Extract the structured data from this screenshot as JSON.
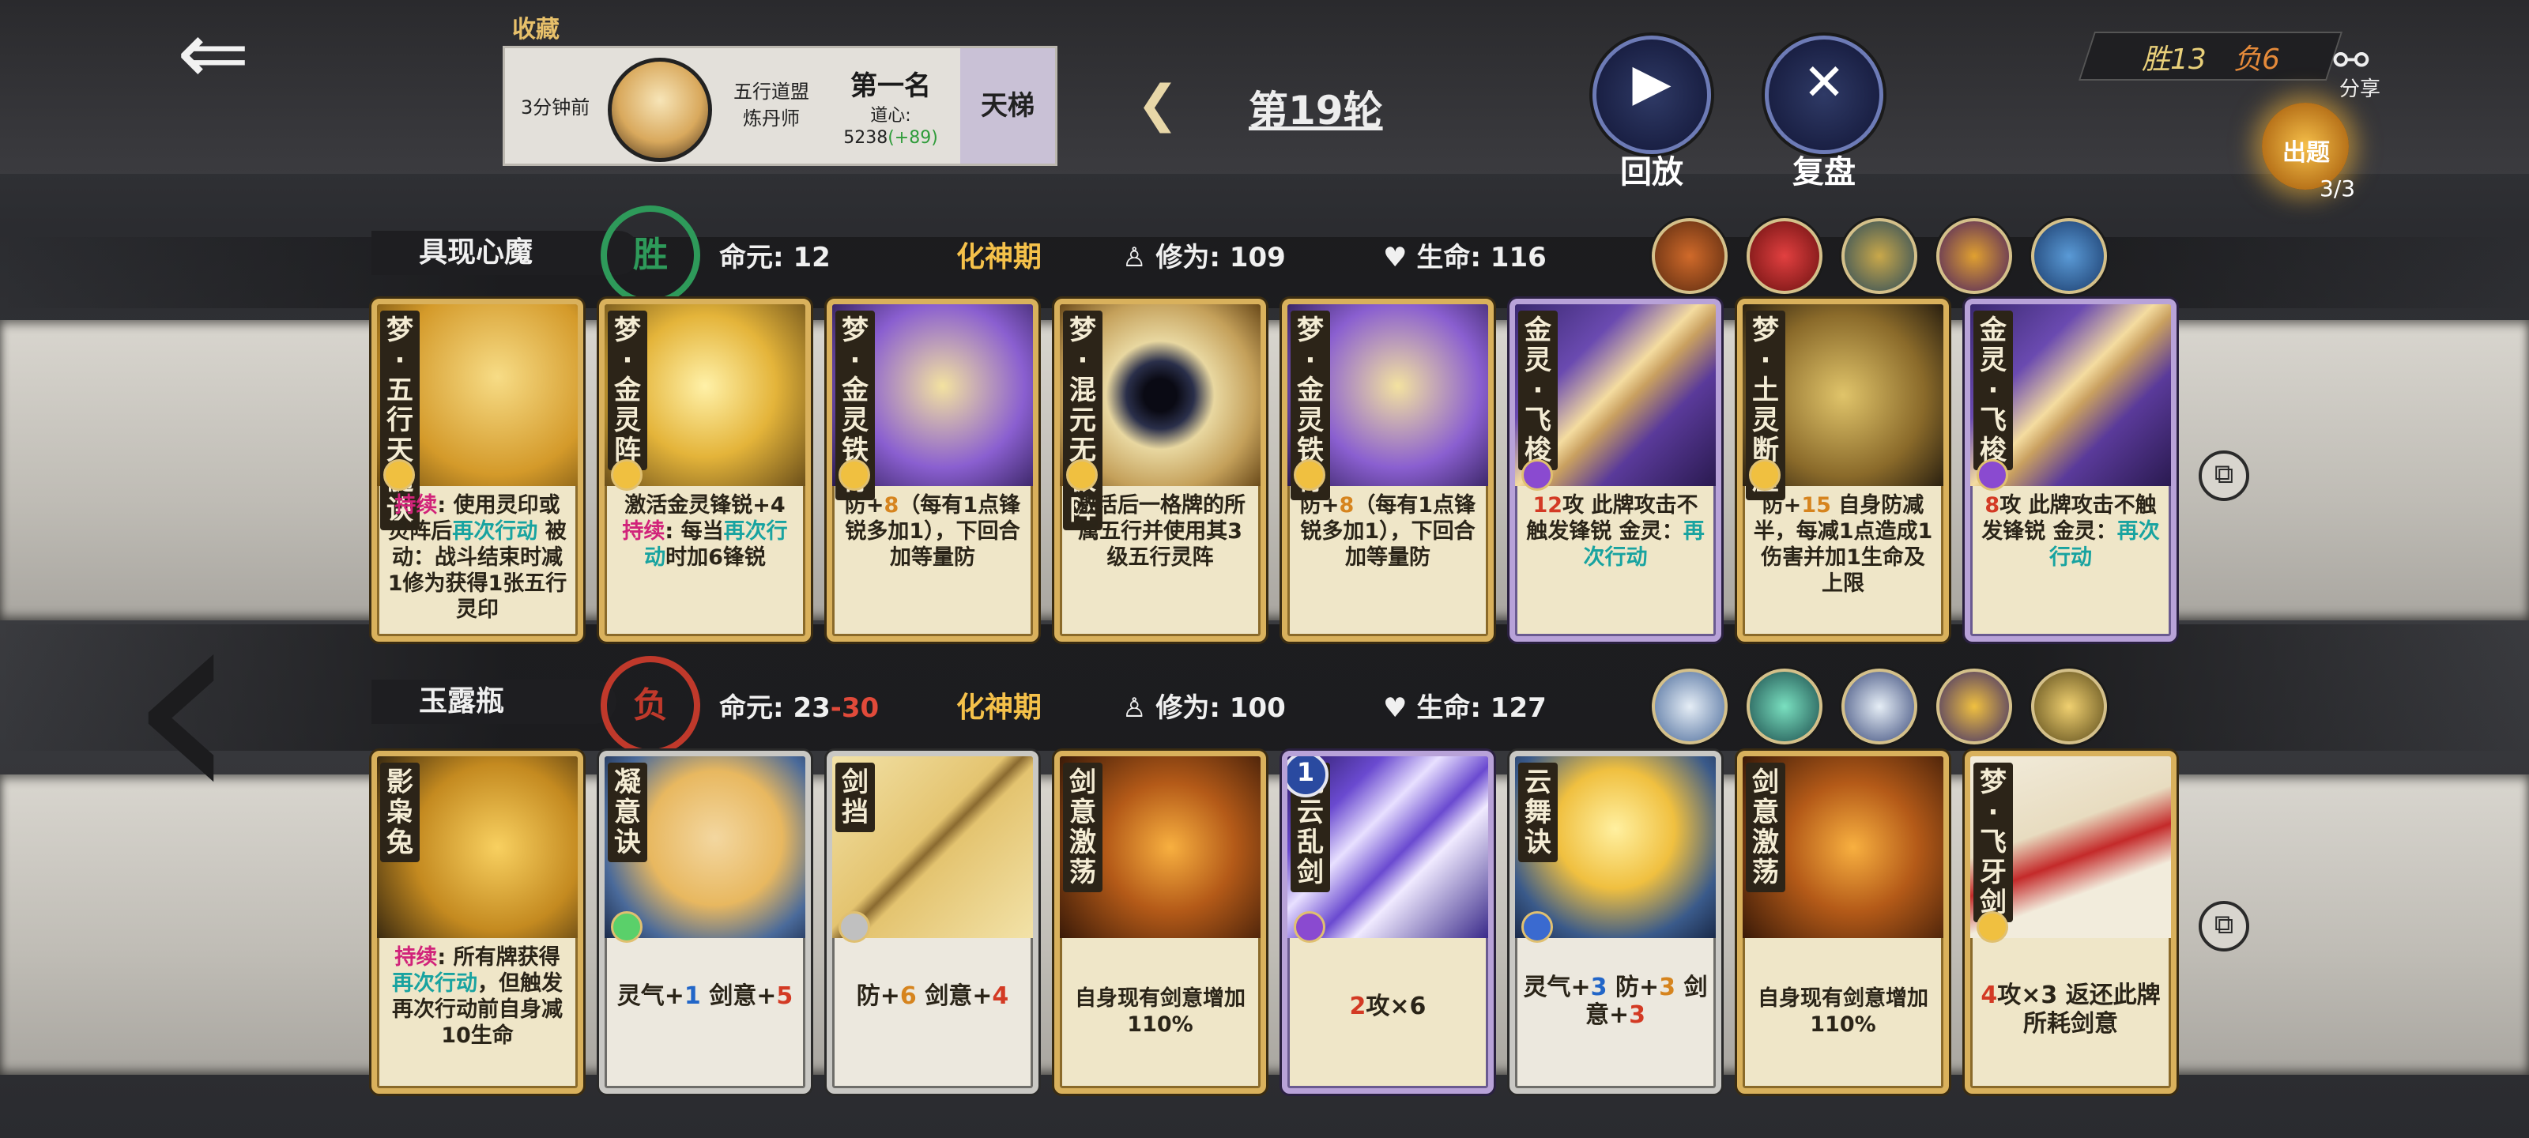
{
  "header": {
    "favorite_label": "收藏",
    "time_ago": "3分钟前",
    "guild_line1": "五行道盟",
    "guild_line2": "炼丹师",
    "rank": "第一名",
    "dao_label": "道心:",
    "dao_value": "5238",
    "dao_delta": "(+89)",
    "ladder": "天梯",
    "round": "第19轮",
    "replay_label": "回放",
    "review_label": "复盘",
    "win_record": "胜13",
    "loss_record": "负6",
    "share_label": "分享",
    "topic_label": "出题",
    "topic_count": "3/3"
  },
  "players": [
    {
      "name": "具现心魔",
      "result": "胜",
      "result_color": "#2e9a5a",
      "life_label": "命元:",
      "life_value": "12",
      "life_loss": "",
      "realm": "化神期",
      "cultivation_label": "修为:",
      "cultivation_value": "109",
      "hp_label": "生命:",
      "hp_value": "116",
      "cards": [
        {
          "name": "梦·五行天髓诀",
          "text_parts": [
            [
              "持续",
              "pink"
            ],
            [
              ": 使用灵印或灵阵后",
              ""
            ],
            [
              "再次行动",
              "teal"
            ],
            [
              " 被动：战斗结束时减1修为获得1张五行灵印",
              ""
            ]
          ]
        },
        {
          "name": "梦·金灵阵",
          "text_parts": [
            [
              "激活金灵锋锐+4 ",
              ""
            ],
            [
              "持续",
              "pink"
            ],
            [
              ": 每当",
              ""
            ],
            [
              "再次行动",
              "teal"
            ],
            [
              "时加6锋锐",
              ""
            ]
          ]
        },
        {
          "name": "梦·金灵铁骨",
          "text_parts": [
            [
              "防+",
              ""
            ],
            [
              "8",
              "orange"
            ],
            [
              "（每有1点锋锐多加1），下回合加等量防",
              ""
            ]
          ]
        },
        {
          "name": "梦·混元无极阵",
          "text_parts": [
            [
              "激活后一格牌的所属五行并使用其3级五行灵阵",
              ""
            ]
          ]
        },
        {
          "name": "梦·金灵铁骨",
          "text_parts": [
            [
              "防+",
              ""
            ],
            [
              "8",
              "orange"
            ],
            [
              "（每有1点锋锐多加1），下回合加等量防",
              ""
            ]
          ]
        },
        {
          "name": "金灵·飞梭",
          "text_parts": [
            [
              "12",
              "red"
            ],
            [
              "攻 此牌攻击不触发锋锐 金灵：",
              ""
            ],
            [
              "再次行动",
              "teal"
            ]
          ]
        },
        {
          "name": "梦·土灵断崖",
          "text_parts": [
            [
              "防+",
              ""
            ],
            [
              "15",
              "orange"
            ],
            [
              " 自身防减半，每减1点造成1伤害并加1生命及上限",
              ""
            ]
          ]
        },
        {
          "name": "金灵·飞梭",
          "text_parts": [
            [
              "8",
              "red"
            ],
            [
              "攻 此牌攻击不触发锋锐 金灵：",
              ""
            ],
            [
              "再次行动",
              "teal"
            ]
          ]
        }
      ]
    },
    {
      "name": "玉露瓶",
      "result": "负",
      "result_color": "#c0392b",
      "life_label": "命元:",
      "life_value": "23",
      "life_loss": "-30",
      "realm": "化神期",
      "cultivation_label": "修为:",
      "cultivation_value": "100",
      "hp_label": "生命:",
      "hp_value": "127",
      "cards": [
        {
          "name": "影枭兔",
          "text_parts": [
            [
              "持续",
              "pink"
            ],
            [
              ": 所有牌获得",
              ""
            ],
            [
              "再次行动",
              "teal"
            ],
            [
              "，但触发再次行动前自身减10生命",
              ""
            ]
          ]
        },
        {
          "name": "凝意诀",
          "text_parts": [
            [
              "灵气+",
              ""
            ],
            [
              "1",
              "blue"
            ],
            [
              " 剑意+",
              ""
            ],
            [
              "5",
              "red"
            ]
          ]
        },
        {
          "name": "剑挡",
          "text_parts": [
            [
              "防+",
              ""
            ],
            [
              "6",
              "orange"
            ],
            [
              " 剑意+",
              ""
            ],
            [
              "4",
              "red"
            ]
          ]
        },
        {
          "name": "剑意激荡",
          "text_parts": [
            [
              "自身现有剑意增加110%",
              ""
            ]
          ]
        },
        {
          "name": "流云乱剑",
          "text_parts": [
            [
              "2",
              "red"
            ],
            [
              "攻×6",
              ""
            ]
          ]
        },
        {
          "name": "云舞诀",
          "text_parts": [
            [
              "灵气+",
              ""
            ],
            [
              "3",
              "blue"
            ],
            [
              " 防+",
              ""
            ],
            [
              "3",
              "orange"
            ],
            [
              " 剑意+",
              ""
            ],
            [
              "3",
              "red"
            ]
          ]
        },
        {
          "name": "剑意激荡",
          "text_parts": [
            [
              "自身现有剑意增加110%",
              ""
            ]
          ]
        },
        {
          "name": "梦·飞牙剑",
          "text_parts": [
            [
              "4",
              "red"
            ],
            [
              "攻×3 返还此牌所耗剑意",
              ""
            ]
          ]
        }
      ]
    }
  ],
  "icon_names": [
    "back-arrow-icon",
    "play-icon",
    "cross-swords-icon",
    "share-icon",
    "copy-icon",
    "chevron-left-icon",
    "meditate-icon",
    "heart-icon"
  ]
}
